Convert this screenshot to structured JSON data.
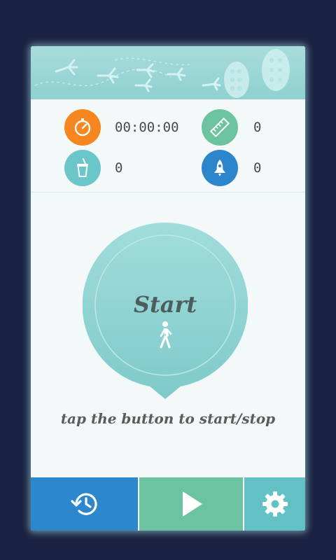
{
  "stats": {
    "timer": {
      "icon": "stopwatch-icon",
      "value": "00:00:00",
      "color": "#f6861f"
    },
    "distance": {
      "icon": "ruler-icon",
      "value": "0",
      "color": "#6cc3a0"
    },
    "drink": {
      "icon": "drink-cup-icon",
      "value": "0",
      "color": "#6ac6c9"
    },
    "speed": {
      "icon": "rocket-icon",
      "value": "0",
      "color": "#2d85cc"
    }
  },
  "start_button": {
    "label": "Start",
    "icon": "walking-person-icon",
    "color": "#8fd3d3"
  },
  "hint": "tap the button to start/stop",
  "bottom_nav": {
    "history": {
      "icon": "history-clock-icon",
      "color": "#2c87cd"
    },
    "play": {
      "icon": "play-icon",
      "color": "#6cc3a0"
    },
    "settings": {
      "icon": "gear-icon",
      "color": "#62c1c4"
    }
  }
}
